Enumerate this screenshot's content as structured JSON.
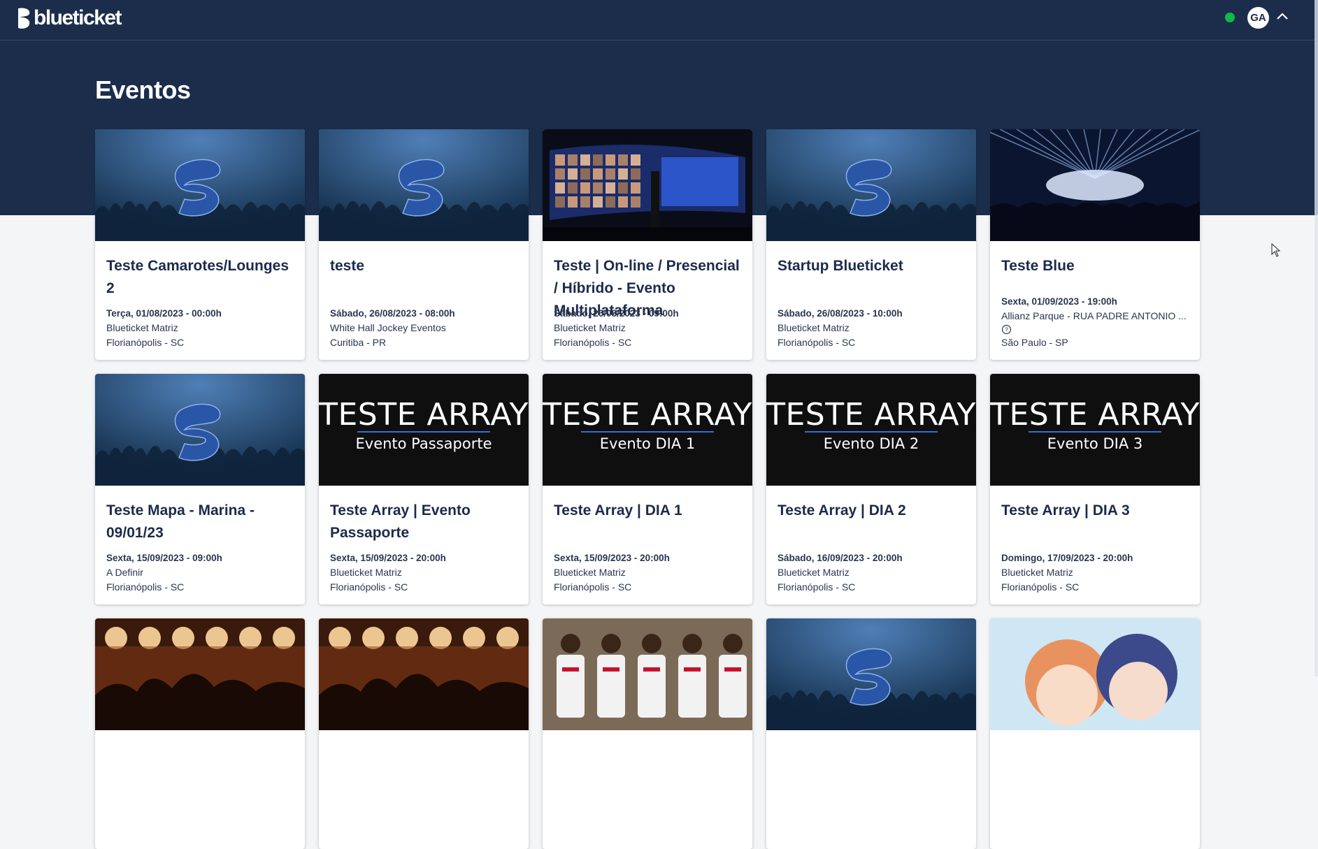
{
  "app": {
    "logo_text": "blueticket",
    "user_initials": "GA",
    "brand_color": "#1c2d4c",
    "status_color": "#10b84a"
  },
  "page": {
    "title": "Eventos"
  },
  "events": [
    {
      "title": "Teste Camarotes/Lounges 2",
      "date": "Terça, 01/08/2023 - 00:00h",
      "venue": "Blueticket Matriz",
      "city": "Florianópolis - SC",
      "image": "blueticket-default"
    },
    {
      "title": "teste",
      "date": "Sábado, 26/08/2023 - 08:00h",
      "venue": "White Hall Jockey Eventos",
      "city": "Curitiba - PR",
      "image": "blueticket-default"
    },
    {
      "title": "Teste | On-line / Presencial / Híbrido - Evento Multiplataforma",
      "date": "Sábado, 26/08/2023 - 09:00h",
      "venue": "Blueticket Matriz",
      "city": "Florianópolis - SC",
      "image": "video-wall-photo"
    },
    {
      "title": "Startup Blueticket",
      "date": "Sábado, 26/08/2023 - 10:00h",
      "venue": "Blueticket Matriz",
      "city": "Florianópolis - SC",
      "image": "blueticket-default"
    },
    {
      "title": "Teste Blue",
      "date": "Sexta, 01/09/2023 - 19:00h",
      "venue": "Allianz Parque - RUA PADRE ANTONIO ...",
      "city": "São Paulo - SP",
      "image": "concert-lights-photo",
      "help_icon": "help-circle-icon"
    },
    {
      "title": "Teste Mapa - Marina - 09/01/23",
      "date": "Sexta, 15/09/2023 - 09:00h",
      "venue": "A Definir",
      "city": "Florianópolis - SC",
      "image": "blueticket-default"
    },
    {
      "title": "Teste Array | Evento Passaporte",
      "date": "Sexta, 15/09/2023 - 20:00h",
      "venue": "Blueticket Matriz",
      "city": "Florianópolis - SC",
      "image": "array-banner",
      "banner_big": "TESTE ARRAY",
      "banner_small": "Evento Passaporte"
    },
    {
      "title": "Teste Array | DIA 1",
      "date": "Sexta, 15/09/2023 - 20:00h",
      "venue": "Blueticket Matriz",
      "city": "Florianópolis - SC",
      "image": "array-banner",
      "banner_big": "TESTE ARRAY",
      "banner_small": "Evento DIA 1"
    },
    {
      "title": "Teste Array | DIA 2",
      "date": "Sábado, 16/09/2023 - 20:00h",
      "venue": "Blueticket Matriz",
      "city": "Florianópolis - SC",
      "image": "array-banner",
      "banner_big": "TESTE ARRAY",
      "banner_small": "Evento DIA 2"
    },
    {
      "title": "Teste Array | DIA 3",
      "date": "Domingo, 17/09/2023 - 20:00h",
      "venue": "Blueticket Matriz",
      "city": "Florianópolis - SC",
      "image": "array-banner",
      "banner_big": "TESTE ARRAY",
      "banner_small": "Evento DIA 3"
    },
    {
      "image": "stage-lights-photo"
    },
    {
      "image": "stage-lights-photo"
    },
    {
      "image": "basketball-team-photo"
    },
    {
      "image": "blueticket-default"
    },
    {
      "image": "anime-illustration"
    }
  ]
}
